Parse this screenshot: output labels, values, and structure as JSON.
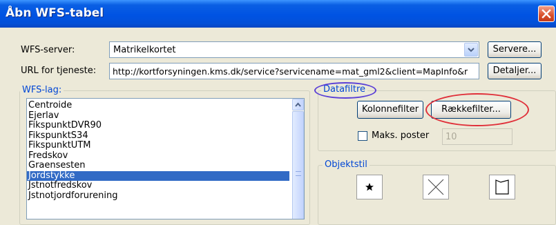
{
  "window": {
    "title": "Åbn WFS-tabel"
  },
  "server": {
    "label": "WFS-server:",
    "value": "Matrikelkortet",
    "button": "Servere..."
  },
  "url": {
    "label": "URL for tjeneste:",
    "value": "http://kortforsyningen.kms.dk/service?servicename=mat_gml2&client=MapInfo&r",
    "button": "Detaljer..."
  },
  "layers": {
    "label": "WFS-lag:",
    "items": [
      "Centroide",
      "Ejerlav",
      "FikspunktDVR90",
      "FikspunktS34",
      "FikspunktUTM",
      "Fredskov",
      "Graensesten",
      "Jordstykke",
      "Jstnotfredskov",
      "Jstnotjordforurening"
    ],
    "selected": "Jordstykke"
  },
  "datafilters": {
    "label": "Datafiltre",
    "column_filter": "Kolonnefilter",
    "row_filter": "Rækkefilter...",
    "max_records_label": "Maks. poster",
    "max_records_value": "10",
    "max_records_checked": false
  },
  "object_style": {
    "label": "Objektstil",
    "buttons": [
      "star-icon",
      "cross-line-icon",
      "region-icon"
    ]
  },
  "annotations": {
    "datafilter_outline": "#5a3fd6",
    "row_filter_outline": "#e0303a"
  }
}
